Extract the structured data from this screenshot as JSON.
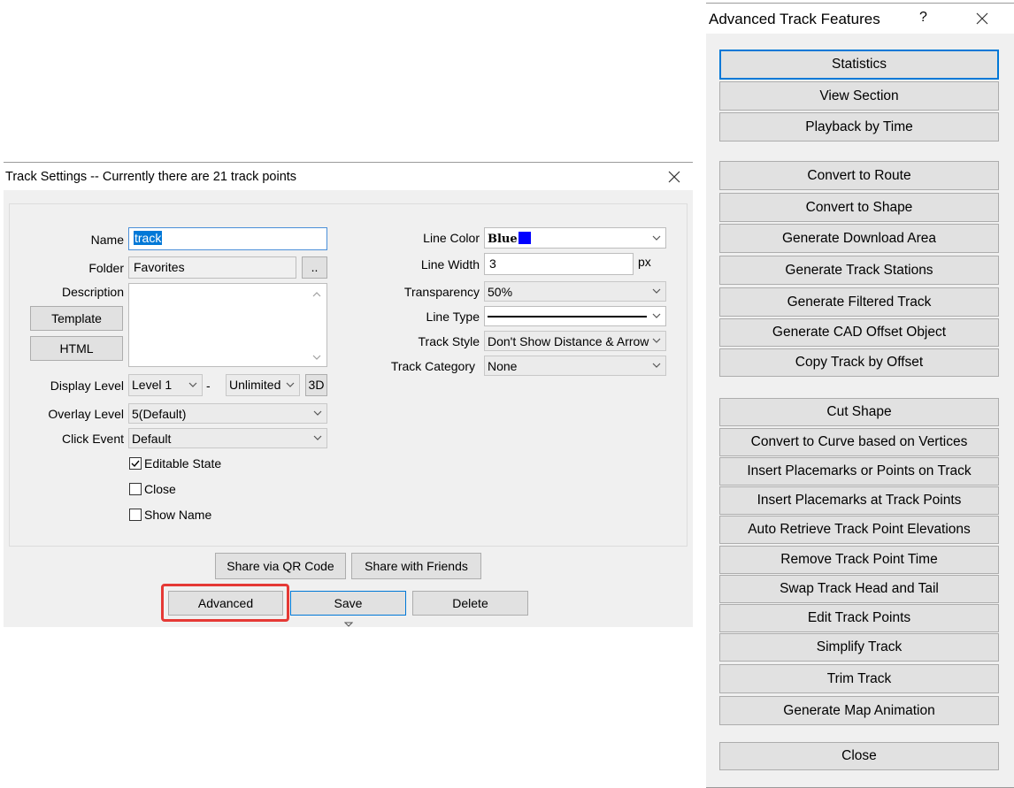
{
  "track_settings": {
    "title": "Track Settings -- Currently there are 21 track points",
    "labels": {
      "name": "Name",
      "folder": "Folder",
      "description": "Description",
      "display_level": "Display Level",
      "overlay_level": "Overlay Level",
      "click_event": "Click Event",
      "line_color": "Line Color",
      "line_width": "Line Width",
      "transparency": "Transparency",
      "line_type": "Line Type",
      "track_style": "Track Style",
      "track_category": "Track Category",
      "px": "px",
      "dash": "-"
    },
    "values": {
      "name": "track",
      "folder": "Favorites",
      "display_level_from": "Level 1",
      "display_level_to": "Unlimited",
      "overlay_level": "5(Default)",
      "click_event": "Default",
      "line_color": "Blue",
      "line_color_swatch": "#0000ff",
      "line_width": "3",
      "transparency": "50%",
      "track_style": "Don't Show Distance & Arrow",
      "track_category": "None"
    },
    "buttons": {
      "folder_browse": "..",
      "template": "Template",
      "html": "HTML",
      "three_d": "3D",
      "share_qr": "Share via QR Code",
      "share_friends": "Share with Friends",
      "advanced": "Advanced",
      "save": "Save",
      "delete": "Delete"
    },
    "checkboxes": [
      {
        "label": "Editable State",
        "checked": true
      },
      {
        "label": "Close",
        "checked": false
      },
      {
        "label": "Show Name",
        "checked": false
      }
    ]
  },
  "advanced_features": {
    "title": "Advanced Track Features",
    "help": "?",
    "buttons": [
      "Statistics",
      "View Section",
      "Playback by Time",
      "Convert to Route",
      "Convert to Shape",
      "Generate Download Area",
      "Generate Track Stations",
      "Generate Filtered Track",
      "Generate CAD Offset Object",
      "Copy Track by Offset",
      "Cut Shape",
      "Convert to Curve based on Vertices",
      "Insert Placemarks or Points on Track",
      "Insert Placemarks at Track Points",
      "Auto Retrieve Track Point Elevations",
      "Remove Track Point Time",
      "Swap Track Head and Tail",
      "Edit Track Points",
      "Simplify Track",
      "Trim Track",
      "Generate Map Animation",
      "Close"
    ]
  },
  "colors": {
    "accent": "#0078d7",
    "highlight": "#e53935"
  }
}
